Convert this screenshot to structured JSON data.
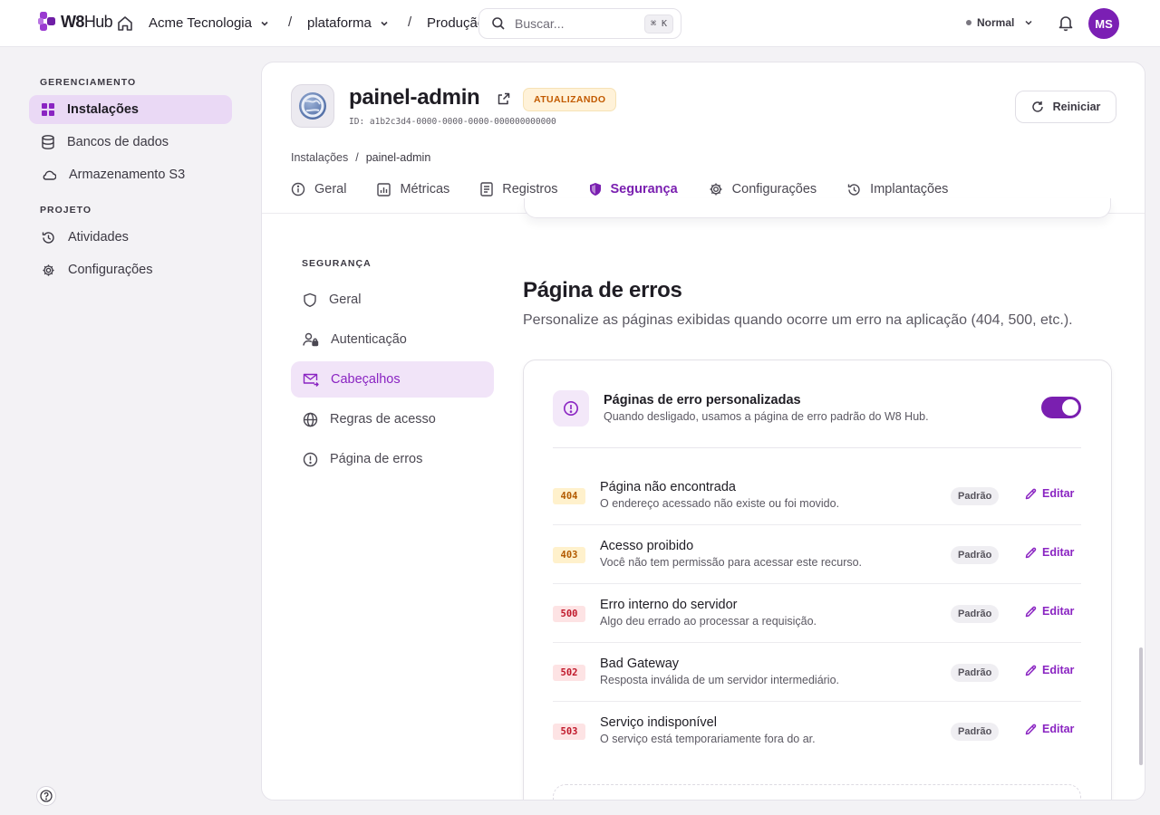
{
  "brand": {
    "logo_text_bold": "W8",
    "logo_text": "Hub",
    "accent": "#8a24c2"
  },
  "topbar": {
    "org": "Acme Tecnologia",
    "project": "plataforma",
    "environment": "Produção",
    "search_placeholder": "Buscar...",
    "search_shortcut": "⌘ K",
    "mode_label": "Normal",
    "avatar_initials": "MS"
  },
  "sidebar": {
    "section_manage": "GERENCIAMENTO",
    "manage_items": [
      {
        "label": "Instalações",
        "icon": "grid-icon",
        "active": true
      },
      {
        "label": "Bancos de dados",
        "icon": "database-icon"
      },
      {
        "label": "Armazenamento S3",
        "icon": "cloud-icon"
      }
    ],
    "section_project": "PROJETO",
    "project_items": [
      {
        "label": "Atividades",
        "icon": "history-icon"
      },
      {
        "label": "Configurações",
        "icon": "gear-icon"
      }
    ]
  },
  "app": {
    "name": "painel-admin",
    "status": "ATUALIZANDO",
    "id_text": "ID: a1b2c3d4-0000-0000-0000-000000000000",
    "restart_label": "Reiniciar",
    "breadcrumb": [
      "Instalações",
      "/",
      "painel-admin"
    ]
  },
  "tabs": [
    {
      "label": "Geral",
      "icon": "info-icon"
    },
    {
      "label": "Métricas",
      "icon": "chart-icon"
    },
    {
      "label": "Registros",
      "icon": "file-icon"
    },
    {
      "label": "Segurança",
      "icon": "shield-icon",
      "active": true
    },
    {
      "label": "Configurações",
      "icon": "gear-icon"
    },
    {
      "label": "Implantações",
      "icon": "history-icon"
    }
  ],
  "security_nav": {
    "title": "SEGURANÇA",
    "items": [
      {
        "label": "Geral",
        "icon": "shield-icon"
      },
      {
        "label": "Autenticação",
        "icon": "user-lock-icon"
      },
      {
        "label": "Cabeçalhos",
        "icon": "mail-icon",
        "active": true
      },
      {
        "label": "Regras de acesso",
        "icon": "globe-icon"
      },
      {
        "label": "Página de erros",
        "icon": "alert-icon"
      }
    ]
  },
  "error_page": {
    "title": "Página de erros",
    "description": "Personalize as páginas exibidas quando ocorre um erro na aplicação (404, 500, etc.).",
    "toggle_title": "Páginas de erro personalizadas",
    "toggle_desc": "Quando desligado, usamos a página de erro padrão do W8 Hub.",
    "toggle_on": true,
    "default_badge": "Padrão",
    "edit_label": "Editar",
    "rows": [
      {
        "code": "404",
        "level": "warn",
        "title": "Página não encontrada",
        "desc": "O endereço acessado não existe ou foi movido."
      },
      {
        "code": "403",
        "level": "warn",
        "title": "Acesso proibido",
        "desc": "Você não tem permissão para acessar este recurso."
      },
      {
        "code": "500",
        "level": "err",
        "title": "Erro interno do servidor",
        "desc": "Algo deu errado ao processar a requisição."
      },
      {
        "code": "502",
        "level": "err",
        "title": "Bad Gateway",
        "desc": "Resposta inválida de um servidor intermediário."
      },
      {
        "code": "503",
        "level": "err",
        "title": "Serviço indisponível",
        "desc": "O serviço está temporariamente fora do ar."
      }
    ]
  }
}
